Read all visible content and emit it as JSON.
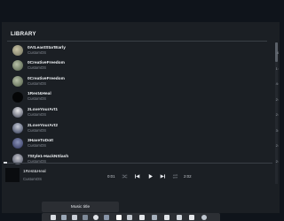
{
  "library": {
    "title": "LIBRARY",
    "tracks": [
      {
        "title": "0AtLeastStartEarly",
        "artist": "CustomOS"
      },
      {
        "title": "0CreativeFreedom",
        "artist": "CustomOS"
      },
      {
        "title": "0CreativeFreedom",
        "artist": "CustomOS"
      },
      {
        "title": "1Rest&Heal",
        "artist": "CustomOS"
      },
      {
        "title": "2LoveYourArt1",
        "artist": "CustomOS"
      },
      {
        "title": "2LoveYourArt2",
        "artist": "CustomOS"
      },
      {
        "title": "3HaveToDoIt",
        "artist": "CustomOS"
      },
      {
        "title": "7Style1-HackNSlash",
        "artist": "CustomOS"
      }
    ]
  },
  "now_playing": {
    "title": "1Rest&Heal",
    "artist": "CustomOS",
    "elapsed": "0:01",
    "duration": "2:02"
  },
  "tooltip": "Music title",
  "edge_numbers": [
    "4",
    "1:",
    "4:",
    "2:",
    "2:",
    "3:",
    "2:",
    "2:"
  ],
  "icons": {
    "prev": "skip-back-icon",
    "play": "play-icon",
    "next": "skip-forward-icon",
    "shuffle": "shuffle-icon",
    "repeat": "repeat-icon"
  }
}
